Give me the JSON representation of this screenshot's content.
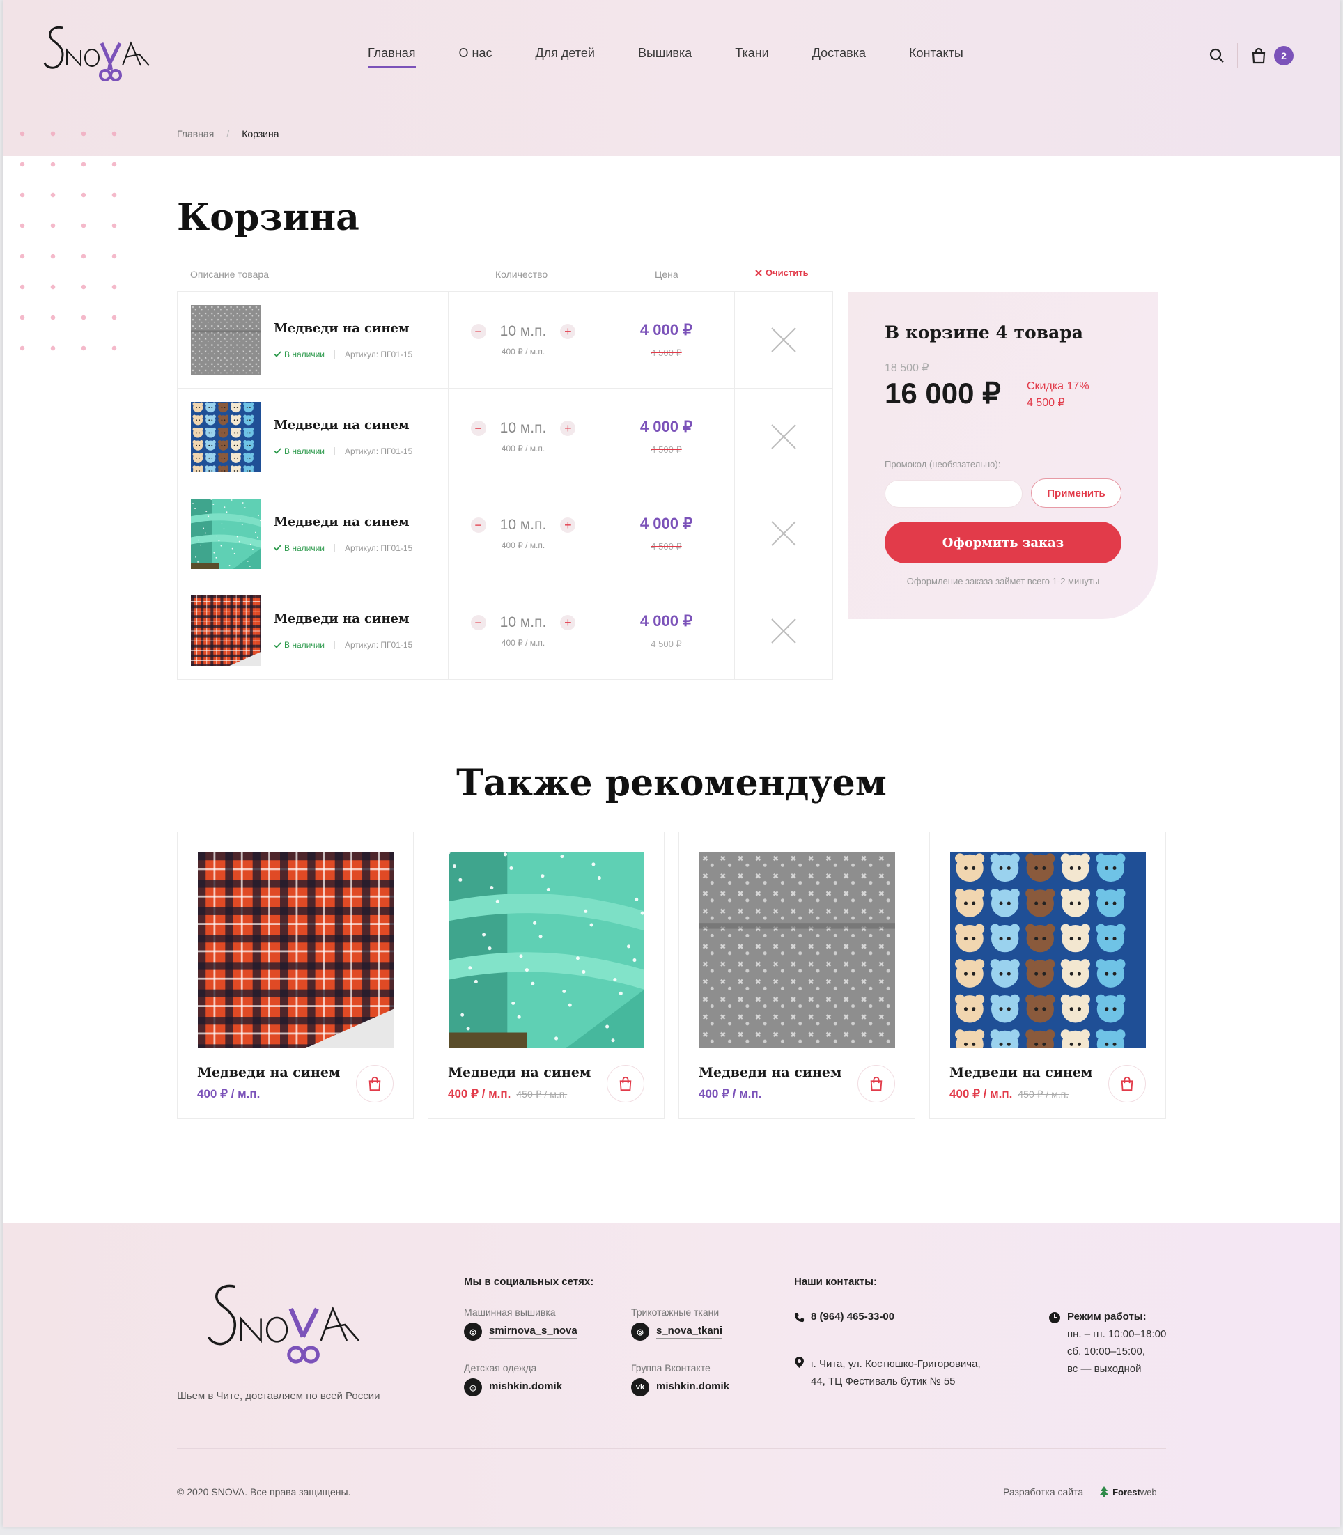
{
  "brand": {
    "logo_text": "SNOVA"
  },
  "nav": {
    "items": [
      "Главная",
      "О нас",
      "Для детей",
      "Вышивка",
      "Ткани",
      "Доставка",
      "Контакты"
    ],
    "active": "Главная"
  },
  "header": {
    "cart_count": "2",
    "icons": [
      "search-icon",
      "shopping-bag-icon"
    ]
  },
  "breadcrumb": {
    "home": "Главная",
    "separator": "/",
    "current": "Корзина"
  },
  "cart": {
    "title": "Корзина",
    "columns": {
      "description": "Описание товара",
      "quantity": "Количество",
      "price": "Цена"
    },
    "clear_label": "Очистить",
    "items": [
      {
        "name": "Медведи на синем",
        "stock": "В наличии",
        "sku": "Артикул: ПГ01-15",
        "qty": "10 м.п.",
        "unit_price": "400 ₽ / м.п.",
        "price": "4 000 ₽",
        "old_price": "4 500 ₽",
        "image": "grey-pattern-fabric"
      },
      {
        "name": "Медведи на синем",
        "stock": "В наличии",
        "sku": "Артикул: ПГ01-15",
        "qty": "10 м.п.",
        "unit_price": "400 ₽ / м.п.",
        "price": "4 000 ₽",
        "old_price": "4 500 ₽",
        "image": "blue-bears-fabric"
      },
      {
        "name": "Медведи на синем",
        "stock": "В наличии",
        "sku": "Артикул: ПГ01-15",
        "qty": "10 м.п.",
        "unit_price": "400 ₽ / м.п.",
        "price": "4 000 ₽",
        "old_price": "4 500 ₽",
        "image": "mint-stars-fabric"
      },
      {
        "name": "Медведи на синем",
        "stock": "В наличии",
        "sku": "Артикул: ПГ01-15",
        "qty": "10 м.п.",
        "unit_price": "400 ₽ / м.п.",
        "price": "4 000 ₽",
        "old_price": "4 500 ₽",
        "image": "red-plaid-fabric"
      }
    ]
  },
  "summary": {
    "title": "В корзине 4 товара",
    "old_total": "18 500 ₽",
    "total": "16 000 ₽",
    "discount_label": "Скидка 17%",
    "discount_amount": "4 500 ₽",
    "promo_label": "Промокод (необязательно):",
    "promo_placeholder": "",
    "apply_label": "Применить",
    "order_label": "Оформить заказ",
    "order_note": "Оформление заказа займет всего 1-2 минуты"
  },
  "recommend": {
    "title": "Также рекомендуем",
    "items": [
      {
        "name": "Медведи на синем",
        "price": "400 ₽ / м.п.",
        "old_price": "",
        "price_color": "#7b52b9",
        "image": "red-plaid-fabric"
      },
      {
        "name": "Медведи на синем",
        "price": "400 ₽ / м.п.",
        "old_price": "450 ₽ / м.п.",
        "price_color": "#e23b4a",
        "image": "mint-stars-fabric"
      },
      {
        "name": "Медведи на синем",
        "price": "400 ₽ / м.п.",
        "old_price": "",
        "price_color": "#7b52b9",
        "image": "grey-pattern-fabric"
      },
      {
        "name": "Медведи на синем",
        "price": "400 ₽ / м.п.",
        "old_price": "450 ₽ / м.п.",
        "price_color": "#e23b4a",
        "image": "blue-bears-fabric"
      }
    ]
  },
  "footer": {
    "tagline": "Шьем в Чите, доставляем по всей России",
    "social_title": "Мы в социальных сетях:",
    "social": [
      {
        "label": "Машинная вышивка",
        "handle": "smirnova_s_nova",
        "icon": "instagram-icon"
      },
      {
        "label": "Трикотажные ткани",
        "handle": "s_nova_tkani",
        "icon": "instagram-icon"
      },
      {
        "label": "Детская одежда",
        "handle": "mishkin.domik",
        "icon": "instagram-icon"
      },
      {
        "label": "Группа Вконтакте",
        "handle": "mishkin.domik",
        "icon": "vk-icon"
      }
    ],
    "contacts_title": "Наши контакты:",
    "phone": "8 (964) 465-33-00",
    "address_line1": "г. Чита, ул. Костюшко-Григоровича,",
    "address_line2": "44, ТЦ Фестиваль бутик № 55",
    "hours_title": "Режим работы:",
    "hours": [
      "пн. – пт. 10:00–18:00",
      "сб. 10:00–15:00,",
      "вс — выходной"
    ],
    "copyright": "© 2020 SNOVA. Все права защищены.",
    "dev_label": "Разработка сайта —",
    "dev_brand_bold": "Forest",
    "dev_brand_rest": "web"
  },
  "colors": {
    "accent": "#7b52b9",
    "red": "#e23b4a",
    "green": "#2f9b4e"
  }
}
